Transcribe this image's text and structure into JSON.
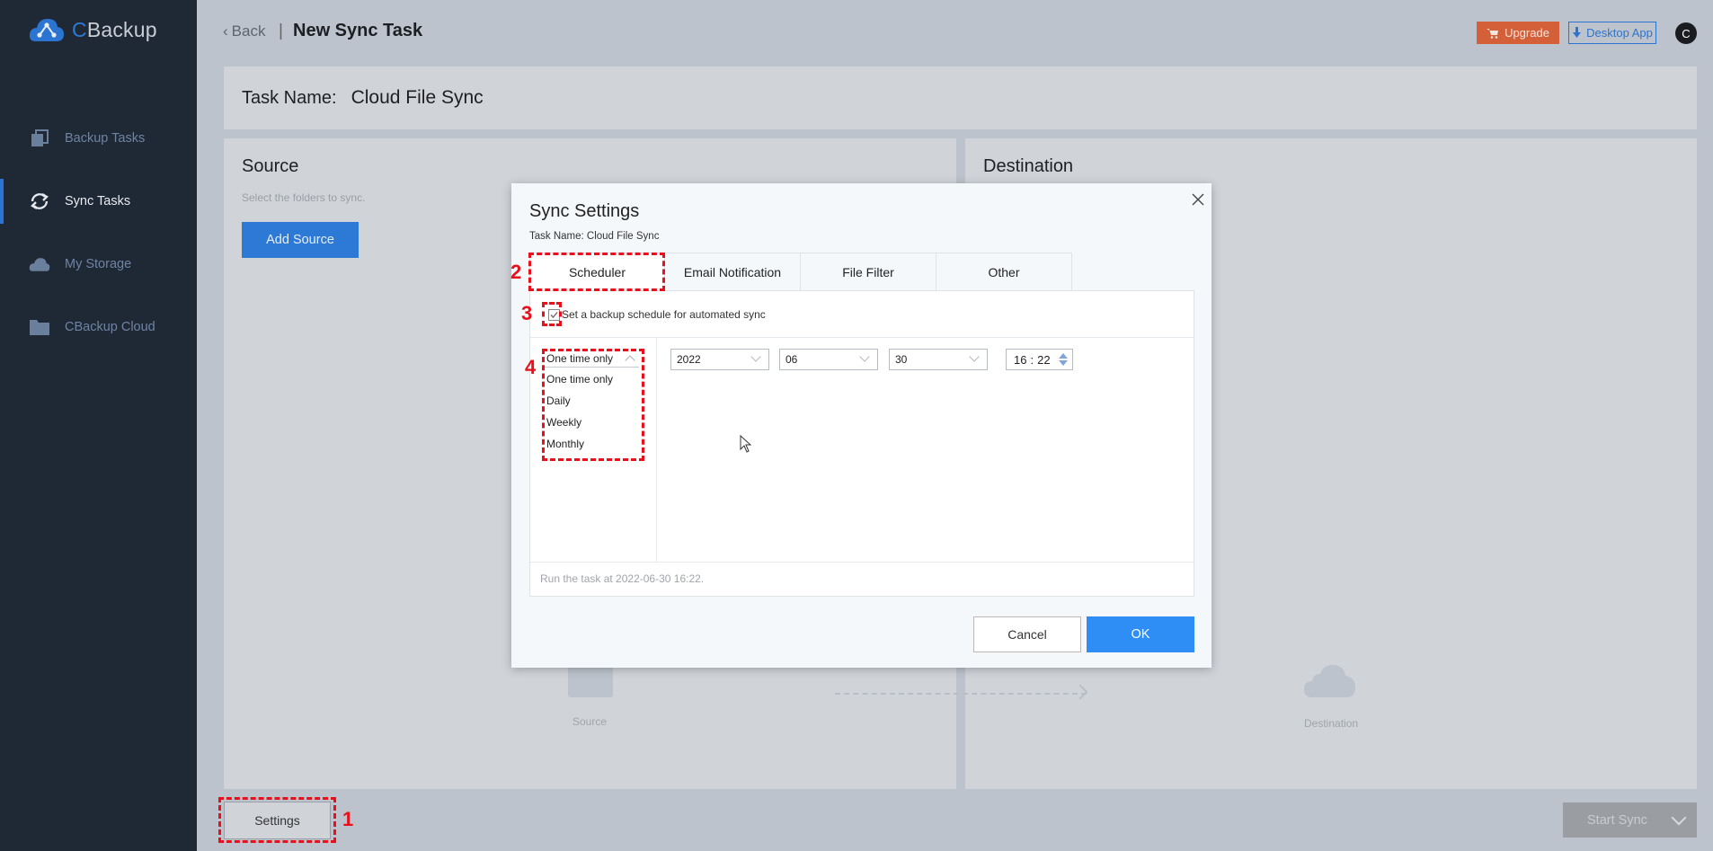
{
  "app": {
    "logo_c": "C",
    "logo_rest": "Backup"
  },
  "sidebar": {
    "items": [
      {
        "label": "Backup Tasks",
        "icon": "backup-tasks-icon",
        "active": false
      },
      {
        "label": "Sync Tasks",
        "icon": "sync-icon",
        "active": true
      },
      {
        "label": "My Storage",
        "icon": "cloud-icon",
        "active": false
      },
      {
        "label": "CBackup Cloud",
        "icon": "folder-icon",
        "active": false
      }
    ]
  },
  "header": {
    "back_label": "Back",
    "separator": "|",
    "title": "New Sync Task",
    "upgrade_label": "Upgrade",
    "desktop_app_label": "Desktop App",
    "avatar_initial": "C"
  },
  "task": {
    "name_label": "Task Name:",
    "name_value": "Cloud File Sync"
  },
  "source_panel": {
    "title": "Source",
    "subtitle": "Select the folders to sync.",
    "add_button": "Add Source",
    "placeholder_label": "Source"
  },
  "destination_panel": {
    "title": "Destination",
    "placeholder_label": "Destination"
  },
  "footer": {
    "settings_label": "Settings",
    "start_sync_label": "Start Sync"
  },
  "annotations": [
    "1",
    "2",
    "3",
    "4"
  ],
  "dialog": {
    "title": "Sync Settings",
    "subtitle": "Task Name: Cloud File Sync",
    "tabs": [
      {
        "label": "Scheduler",
        "active": true
      },
      {
        "label": "Email Notification",
        "active": false
      },
      {
        "label": "File Filter",
        "active": false
      },
      {
        "label": "Other",
        "active": false
      }
    ],
    "schedule_checkbox_label": "Set a backup schedule for automated sync",
    "schedule_checked": true,
    "frequency": {
      "selected": "One time only",
      "options": [
        "One time only",
        "Daily",
        "Weekly",
        "Monthly"
      ]
    },
    "date": {
      "year": "2022",
      "month": "06",
      "day": "30"
    },
    "time": {
      "hour": "16",
      "separator": ":",
      "minute": "22"
    },
    "run_summary": "Run the task at 2022-06-30 16:22.",
    "cancel_label": "Cancel",
    "ok_label": "OK"
  },
  "colors": {
    "accent": "#2d7ad6",
    "ok_button": "#2f8ef5",
    "upgrade": "#d4603a",
    "annotation": "#e8101a",
    "sidebar_bg": "#1f2835"
  }
}
